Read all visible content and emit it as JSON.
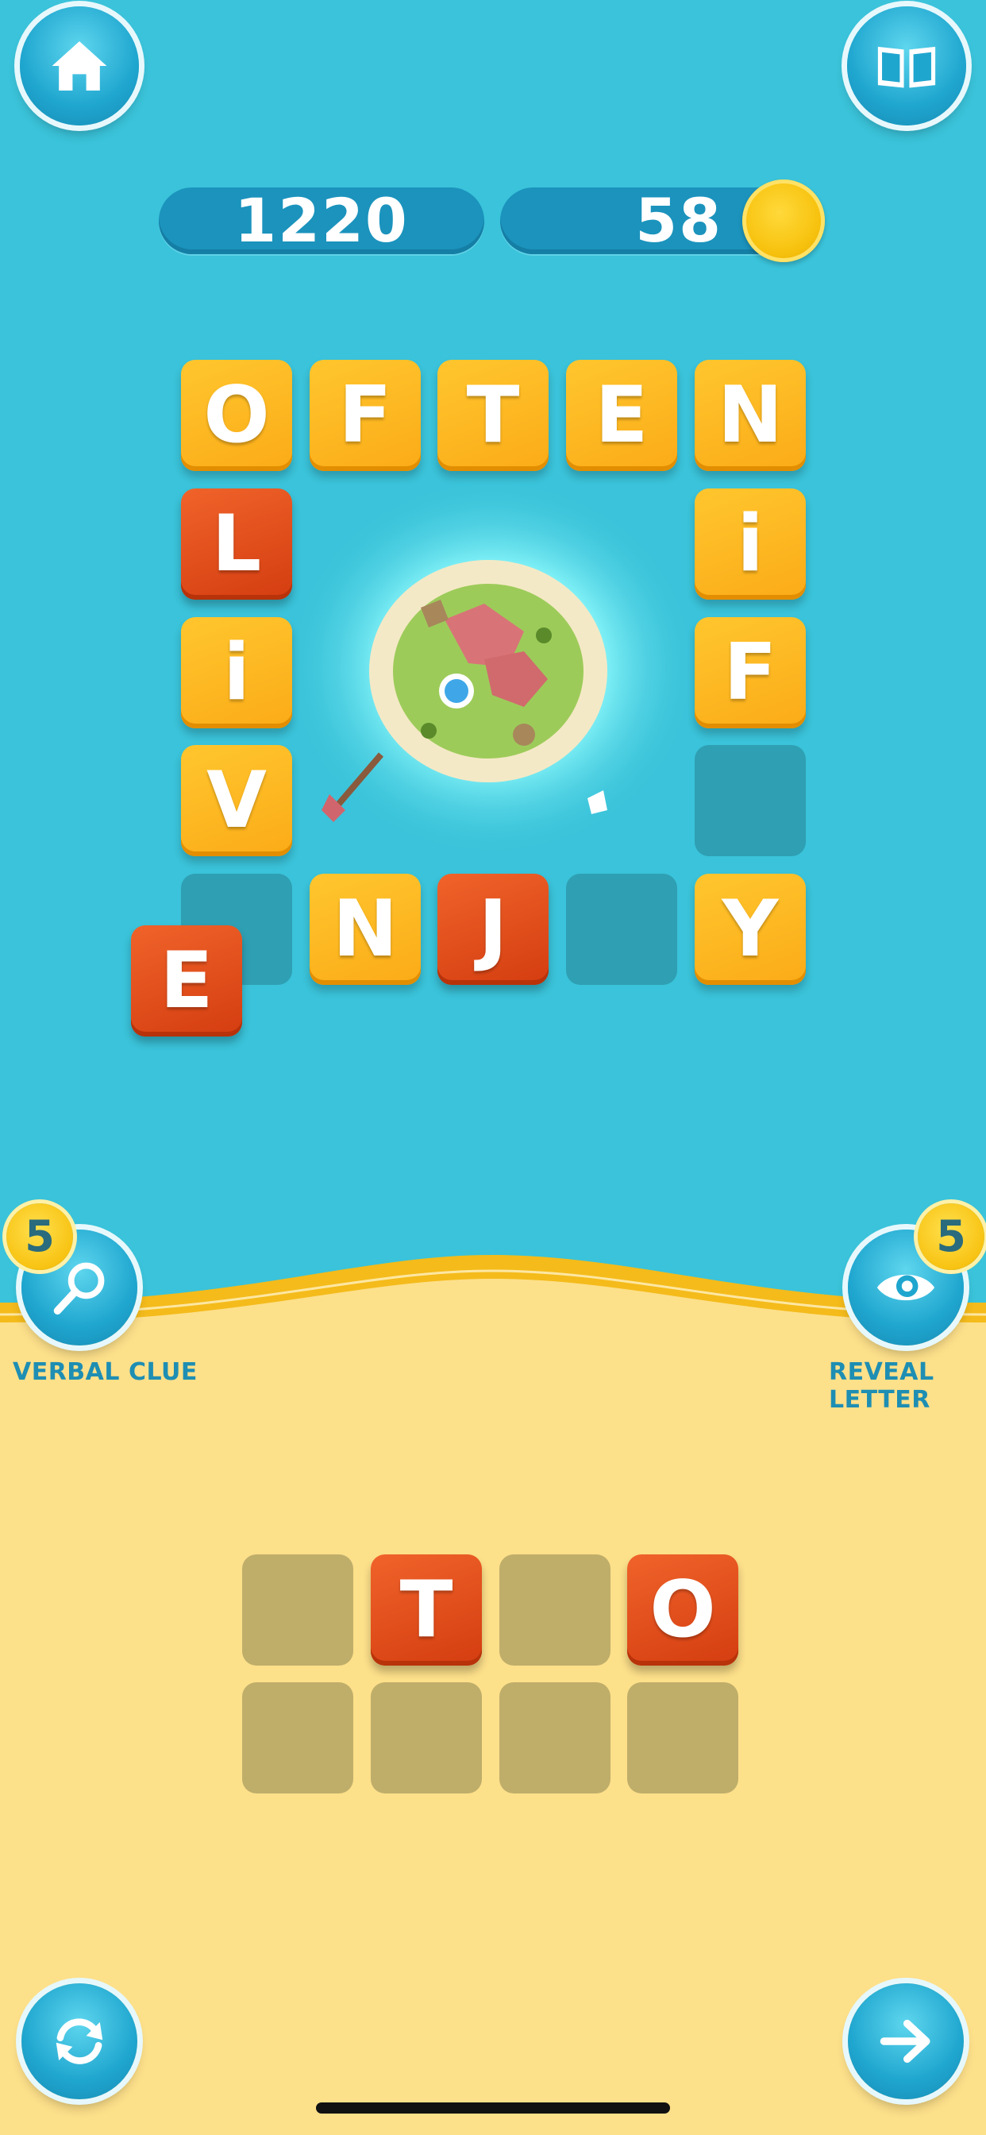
{
  "header": {
    "score": "1220",
    "coins": "58",
    "home_icon": "home-icon",
    "book_icon": "book-icon"
  },
  "board": {
    "top_row": [
      "O",
      "F",
      "T",
      "E",
      "N"
    ],
    "left_column": [
      "L",
      "i",
      "V"
    ],
    "right_column": [
      "i",
      "F"
    ],
    "bottom_row": [
      "N",
      "J",
      "Y"
    ],
    "dragged_tile": "E"
  },
  "helpers": {
    "verbal_clue": {
      "label": "VERBAL CLUE",
      "count": "5",
      "icon": "magnifier-icon"
    },
    "reveal_letter": {
      "label": "REVEAL LETTER",
      "count": "5",
      "icon": "eye-icon"
    }
  },
  "answer": {
    "row1": [
      "",
      "T",
      "",
      "O"
    ],
    "row2": [
      "",
      "",
      "",
      ""
    ]
  },
  "footer": {
    "shuffle_icon": "refresh-icon",
    "next_icon": "arrow-right-icon"
  },
  "colors": {
    "sea": "#3ac3da",
    "sand": "#fedd86",
    "tile_yellow": "#fbab17",
    "tile_red": "#d43d10"
  }
}
